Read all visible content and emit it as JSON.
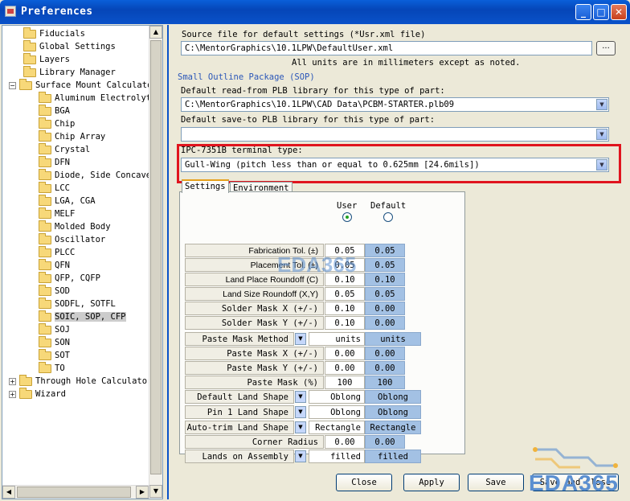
{
  "window": {
    "title": "Preferences"
  },
  "titlebar_buttons": {
    "minimize": "_",
    "maximize": "□",
    "close": "✕"
  },
  "tree": {
    "items": [
      {
        "label": "Fiducials",
        "indent": 1,
        "expander": "",
        "selected": false
      },
      {
        "label": "Global Settings",
        "indent": 1,
        "expander": "",
        "selected": false
      },
      {
        "label": "Layers",
        "indent": 1,
        "expander": "",
        "selected": false
      },
      {
        "label": "Library Manager",
        "indent": 1,
        "expander": "",
        "selected": false
      },
      {
        "label": "Surface Mount Calculators",
        "indent": 0,
        "expander": "−",
        "selected": false
      },
      {
        "label": "Aluminum Electrolytic (",
        "indent": 2,
        "expander": "",
        "selected": false
      },
      {
        "label": "BGA",
        "indent": 2,
        "expander": "",
        "selected": false
      },
      {
        "label": "Chip",
        "indent": 2,
        "expander": "",
        "selected": false
      },
      {
        "label": "Chip Array",
        "indent": 2,
        "expander": "",
        "selected": false
      },
      {
        "label": "Crystal",
        "indent": 2,
        "expander": "",
        "selected": false
      },
      {
        "label": "DFN",
        "indent": 2,
        "expander": "",
        "selected": false
      },
      {
        "label": "Diode, Side Concave",
        "indent": 2,
        "expander": "",
        "selected": false
      },
      {
        "label": "LCC",
        "indent": 2,
        "expander": "",
        "selected": false
      },
      {
        "label": "LGA, CGA",
        "indent": 2,
        "expander": "",
        "selected": false
      },
      {
        "label": "MELF",
        "indent": 2,
        "expander": "",
        "selected": false
      },
      {
        "label": "Molded Body",
        "indent": 2,
        "expander": "",
        "selected": false
      },
      {
        "label": "Oscillator",
        "indent": 2,
        "expander": "",
        "selected": false
      },
      {
        "label": "PLCC",
        "indent": 2,
        "expander": "",
        "selected": false
      },
      {
        "label": "QFN",
        "indent": 2,
        "expander": "",
        "selected": false
      },
      {
        "label": "QFP, CQFP",
        "indent": 2,
        "expander": "",
        "selected": false
      },
      {
        "label": "SOD",
        "indent": 2,
        "expander": "",
        "selected": false
      },
      {
        "label": "SODFL, SOTFL",
        "indent": 2,
        "expander": "",
        "selected": false
      },
      {
        "label": "SOIC, SOP, CFP",
        "indent": 2,
        "expander": "",
        "selected": true
      },
      {
        "label": "SOJ",
        "indent": 2,
        "expander": "",
        "selected": false
      },
      {
        "label": "SON",
        "indent": 2,
        "expander": "",
        "selected": false
      },
      {
        "label": "SOT",
        "indent": 2,
        "expander": "",
        "selected": false
      },
      {
        "label": "TO",
        "indent": 2,
        "expander": "",
        "selected": false
      },
      {
        "label": "Through Hole Calculators",
        "indent": 0,
        "expander": "+",
        "selected": false
      },
      {
        "label": "Wizard",
        "indent": 0,
        "expander": "+",
        "selected": false
      }
    ]
  },
  "source": {
    "label": "Source file for default settings (*Usr.xml file)",
    "value": "C:\\MentorGraphics\\10.1LPW\\DefaultUser.xml",
    "browse": "...",
    "units_note": "All units are in millimeters except as noted."
  },
  "section_title": "Small Outline Package (SOP)",
  "read_lib": {
    "label": "Default read-from PLB library for this type of part:",
    "value": "C:\\MentorGraphics\\10.1LPW\\CAD Data\\PCBM-STARTER.plb09"
  },
  "save_lib": {
    "label": "Default save-to PLB library for this type of part:",
    "value": ""
  },
  "terminal": {
    "label": "IPC-7351B terminal type:",
    "value": "Gull-Wing (pitch less than or equal to 0.625mm [24.6mils])"
  },
  "tabs": [
    "Settings",
    "Environment"
  ],
  "columns": {
    "user": "User",
    "default": "Default"
  },
  "rows": [
    {
      "label": "Fabrication Tol. (±)",
      "user": "0.05",
      "default": "0.05",
      "combo": false,
      "mono": false
    },
    {
      "label": "Placement Tol. (±)",
      "user": "0.05",
      "default": "0.05",
      "combo": false,
      "mono": false
    },
    {
      "label": "Land Place Roundoff (C)",
      "user": "0.10",
      "default": "0.10",
      "combo": false,
      "mono": false
    },
    {
      "label": "Land Size Roundoff (X,Y)",
      "user": "0.05",
      "default": "0.05",
      "combo": false,
      "mono": false
    },
    {
      "label": "Solder Mask X (+/-)",
      "user": "0.10",
      "default": "0.00",
      "combo": false,
      "mono": true
    },
    {
      "label": "Solder Mask Y (+/-)",
      "user": "0.10",
      "default": "0.00",
      "combo": false,
      "mono": true
    },
    {
      "label": "Paste Mask Method",
      "user": "units",
      "default": "units",
      "combo": true,
      "mono": true
    },
    {
      "label": "Paste Mask X (+/-)",
      "user": "0.00",
      "default": "0.00",
      "combo": false,
      "mono": true
    },
    {
      "label": "Paste Mask Y (+/-)",
      "user": "0.00",
      "default": "0.00",
      "combo": false,
      "mono": true
    },
    {
      "label": "Paste Mask (%)",
      "user": "100",
      "default": "100",
      "combo": false,
      "mono": true
    },
    {
      "label": "Default Land Shape",
      "user": "Oblong",
      "default": "Oblong",
      "combo": true,
      "mono": true
    },
    {
      "label": "Pin 1 Land Shape",
      "user": "Oblong",
      "default": "Oblong",
      "combo": true,
      "mono": true
    },
    {
      "label": "Auto-trim Land Shape",
      "user": "Rectangle",
      "default": "Rectangle",
      "combo": true,
      "mono": true
    },
    {
      "label": "Corner Radius",
      "user": "0.00",
      "default": "0.00",
      "combo": false,
      "mono": true
    },
    {
      "label": "Lands on Assembly",
      "user": "filled",
      "default": "filled",
      "combo": true,
      "mono": true
    }
  ],
  "buttons": {
    "close": "Close",
    "apply": "Apply",
    "save": "Save",
    "save_and_close": "Save and Close"
  },
  "watermark": {
    "center": "EDA365",
    "corner": "EDA365"
  },
  "colors": {
    "highlight_box": "#e0141e",
    "default_cell": "#a3c1e4",
    "titlebar": "#0a52c9"
  }
}
